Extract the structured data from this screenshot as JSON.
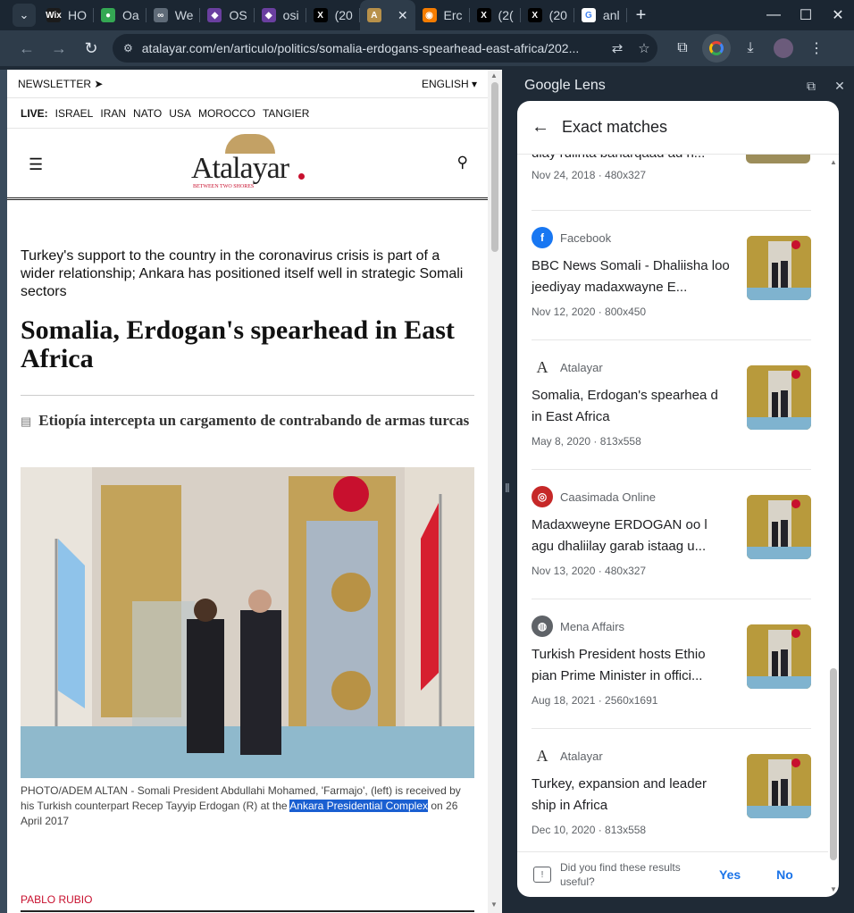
{
  "tabs": [
    {
      "label": "HO",
      "favicon": "wix-icon",
      "color": "#1b1b1b",
      "glyph": "Wix"
    },
    {
      "label": "Oa",
      "favicon": "maps-pin-icon",
      "color": "#34a853",
      "glyph": "●"
    },
    {
      "label": "We",
      "favicon": "link-icon",
      "color": "#5f6b78",
      "glyph": "∞"
    },
    {
      "label": "OS",
      "favicon": "osint-icon",
      "color": "#6a3fa0",
      "glyph": "◆"
    },
    {
      "label": "osi",
      "favicon": "osint-icon",
      "color": "#6a3fa0",
      "glyph": "◆"
    },
    {
      "label": "(20",
      "favicon": "x-icon",
      "color": "#000000",
      "glyph": "X"
    },
    {
      "label": "",
      "favicon": "atalayar-icon",
      "color": "#b8914a",
      "glyph": "A",
      "active": true
    },
    {
      "label": "Erc",
      "favicon": "erc-icon",
      "color": "#f57c00",
      "glyph": "◉"
    },
    {
      "label": "(2(",
      "favicon": "x-icon",
      "color": "#000000",
      "glyph": "X"
    },
    {
      "label": "(20",
      "favicon": "x-icon",
      "color": "#000000",
      "glyph": "X"
    },
    {
      "label": "anl",
      "favicon": "google-icon",
      "color": "#ffffff",
      "glyph": "G"
    }
  ],
  "toolbar": {
    "url": "atalayar.com/en/articulo/politics/somalia-erdogans-spearhead-east-africa/202..."
  },
  "page": {
    "newsletter": "NEWSLETTER",
    "language": "ENGLISH",
    "live_label": "LIVE:",
    "live_items": [
      "ISRAEL",
      "IRAN",
      "NATO",
      "USA",
      "MOROCCO",
      "TANGIER"
    ],
    "logo_word": "Atalayar",
    "logo_tagline": "BETWEEN TWO SHORES",
    "lead": "Turkey's support to the country in the coronavirus crisis is part of a wider relationship; Ankara has positioned itself well in strategic Somali sectors",
    "title": "Somalia, Erdogan's spearhead in East Africa",
    "related": "Etiopía intercepta un cargamento de contrabando de armas turcas",
    "caption_before": "PHOTO/ADEM ALTAN - Somali President Abdullahi Mohamed, 'Farmajo', (left) is received by his Turkish counterpart Recep Tayyip Erdogan (R) at the ",
    "caption_highlight": "Ankara Presidential Complex",
    "caption_after": " on 26 April 2017",
    "author": "PABLO RUBIO"
  },
  "lens": {
    "panel_title": "Google Lens",
    "section_title": "Exact matches",
    "partial": {
      "title": "diay rulinta baharqaad ad n...",
      "meta": "Nov 24, 2018 · 480x327"
    },
    "results": [
      {
        "source": "Facebook",
        "icon": "facebook-icon",
        "icon_color": "#1877f2",
        "icon_glyph": "f",
        "title": "BBC News Somali - Dhaliisha loo jeediyay madaxwayne E...",
        "meta": "Nov 12, 2020 · 800x450"
      },
      {
        "source": "Atalayar",
        "icon": "atalayar-icon",
        "icon_color": "#ffffff",
        "icon_glyph": "A",
        "title": "Somalia, Erdogan's spearhea d in East Africa",
        "meta": "May 8, 2020 · 813x558"
      },
      {
        "source": "Caasimada Online",
        "icon": "caasimada-icon",
        "icon_color": "#c62828",
        "icon_glyph": "◎",
        "title": "Madaxweyne ERDOGAN oo l agu dhaliilay garab istaag u...",
        "meta": "Nov 13, 2020 · 480x327"
      },
      {
        "source": "Mena Affairs",
        "icon": "globe-icon",
        "icon_color": "#5f6368",
        "icon_glyph": "◍",
        "title": "Turkish President hosts Ethio pian Prime Minister in offici...",
        "meta": "Aug 18, 2021 · 2560x1691"
      },
      {
        "source": "Atalayar",
        "icon": "atalayar-icon",
        "icon_color": "#ffffff",
        "icon_glyph": "A",
        "title": "Turkey, expansion and leader ship in Africa",
        "meta": "Dec 10, 2020 · 813x558"
      }
    ],
    "feedback_question": "Did you find these results useful?",
    "yes": "Yes",
    "no": "No"
  }
}
